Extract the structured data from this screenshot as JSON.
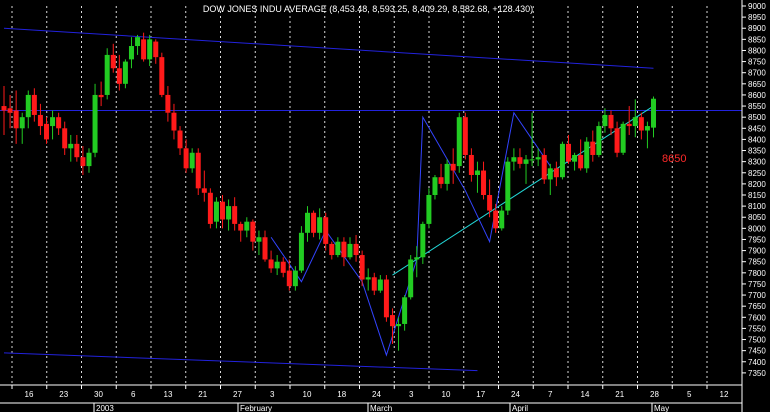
{
  "chart_data": {
    "type": "candlestick",
    "title": "DOW JONES INDU AVERAGE (8,453.48, 8,593.25, 8,409.29, 8,582.68, +128.430)",
    "annotation": "8650",
    "ylim": [
      7300,
      9000
    ],
    "y_ticks": [
      7350,
      7400,
      7450,
      7500,
      7550,
      7600,
      7650,
      7700,
      7750,
      7800,
      7850,
      7900,
      7950,
      8000,
      8050,
      8100,
      8150,
      8200,
      8250,
      8300,
      8350,
      8400,
      8450,
      8500,
      8550,
      8600,
      8650,
      8700,
      8750,
      8800,
      8850,
      8900,
      8950,
      9000
    ],
    "x_day_labels": [
      "16",
      "23",
      "30",
      "6",
      "13",
      "21",
      "27",
      "3",
      "10",
      "18",
      "24",
      "3",
      "10",
      "17",
      "24",
      "7",
      "14",
      "21",
      "28",
      "5",
      "12"
    ],
    "x_month_labels": [
      "2003",
      "February",
      "March",
      "April",
      "May"
    ],
    "grid": true,
    "colors": {
      "background": "#000000",
      "up_candle": "#22cc22",
      "down_candle": "#ff1a1a",
      "grid": "#ffffff",
      "channel": "#2222dd",
      "resistance": "#2222dd",
      "support": "#22d6d6",
      "pattern": "#3344ff",
      "annotation": "#ff2a2a",
      "text": "#ffffff"
    },
    "candles": [
      {
        "o": 8550,
        "h": 8640,
        "l": 8420,
        "c": 8530
      },
      {
        "o": 8540,
        "h": 8600,
        "l": 8450,
        "c": 8520
      },
      {
        "o": 8530,
        "h": 8620,
        "l": 8380,
        "c": 8450
      },
      {
        "o": 8450,
        "h": 8520,
        "l": 8380,
        "c": 8500
      },
      {
        "o": 8500,
        "h": 8620,
        "l": 8450,
        "c": 8600
      },
      {
        "o": 8600,
        "h": 8630,
        "l": 8480,
        "c": 8510
      },
      {
        "o": 8510,
        "h": 8560,
        "l": 8420,
        "c": 8460
      },
      {
        "o": 8470,
        "h": 8500,
        "l": 8380,
        "c": 8400
      },
      {
        "o": 8460,
        "h": 8530,
        "l": 8400,
        "c": 8500
      },
      {
        "o": 8500,
        "h": 8520,
        "l": 8420,
        "c": 8450
      },
      {
        "o": 8450,
        "h": 8480,
        "l": 8330,
        "c": 8360
      },
      {
        "o": 8360,
        "h": 8420,
        "l": 8300,
        "c": 8380
      },
      {
        "o": 8380,
        "h": 8420,
        "l": 8300,
        "c": 8320
      },
      {
        "o": 8320,
        "h": 8370,
        "l": 8240,
        "c": 8280
      },
      {
        "o": 8280,
        "h": 8360,
        "l": 8250,
        "c": 8340
      },
      {
        "o": 8340,
        "h": 8650,
        "l": 8320,
        "c": 8600
      },
      {
        "o": 8600,
        "h": 8660,
        "l": 8550,
        "c": 8590
      },
      {
        "o": 8600,
        "h": 8810,
        "l": 8580,
        "c": 8780
      },
      {
        "o": 8780,
        "h": 8830,
        "l": 8700,
        "c": 8720
      },
      {
        "o": 8720,
        "h": 8780,
        "l": 8620,
        "c": 8650
      },
      {
        "o": 8650,
        "h": 8760,
        "l": 8630,
        "c": 8750
      },
      {
        "o": 8760,
        "h": 8860,
        "l": 8720,
        "c": 8820
      },
      {
        "o": 8820,
        "h": 8870,
        "l": 8780,
        "c": 8860
      },
      {
        "o": 8850,
        "h": 8880,
        "l": 8750,
        "c": 8760
      },
      {
        "o": 8760,
        "h": 8870,
        "l": 8730,
        "c": 8850
      },
      {
        "o": 8840,
        "h": 8850,
        "l": 8740,
        "c": 8770
      },
      {
        "o": 8770,
        "h": 8790,
        "l": 8590,
        "c": 8600
      },
      {
        "o": 8600,
        "h": 8640,
        "l": 8480,
        "c": 8520
      },
      {
        "o": 8520,
        "h": 8560,
        "l": 8400,
        "c": 8440
      },
      {
        "o": 8440,
        "h": 8460,
        "l": 8330,
        "c": 8360
      },
      {
        "o": 8360,
        "h": 8400,
        "l": 8250,
        "c": 8270
      },
      {
        "o": 8270,
        "h": 8360,
        "l": 8250,
        "c": 8340
      },
      {
        "o": 8340,
        "h": 8360,
        "l": 8150,
        "c": 8180
      },
      {
        "o": 8180,
        "h": 8260,
        "l": 8120,
        "c": 8160
      },
      {
        "o": 8160,
        "h": 8180,
        "l": 8000,
        "c": 8020
      },
      {
        "o": 8030,
        "h": 8140,
        "l": 8000,
        "c": 8120
      },
      {
        "o": 8120,
        "h": 8150,
        "l": 8000,
        "c": 8040
      },
      {
        "o": 8040,
        "h": 8130,
        "l": 7990,
        "c": 8100
      },
      {
        "o": 8100,
        "h": 8140,
        "l": 7990,
        "c": 8020
      },
      {
        "o": 8020,
        "h": 8030,
        "l": 7940,
        "c": 7990
      },
      {
        "o": 7990,
        "h": 8050,
        "l": 7960,
        "c": 8030
      },
      {
        "o": 8030,
        "h": 8040,
        "l": 7900,
        "c": 7940
      },
      {
        "o": 7940,
        "h": 7990,
        "l": 7880,
        "c": 7960
      },
      {
        "o": 7960,
        "h": 7990,
        "l": 7850,
        "c": 7860
      },
      {
        "o": 7860,
        "h": 7900,
        "l": 7800,
        "c": 7820
      },
      {
        "o": 7820,
        "h": 7880,
        "l": 7790,
        "c": 7850
      },
      {
        "o": 7850,
        "h": 7870,
        "l": 7780,
        "c": 7800
      },
      {
        "o": 7810,
        "h": 7860,
        "l": 7720,
        "c": 7740
      },
      {
        "o": 7740,
        "h": 7830,
        "l": 7720,
        "c": 7810
      },
      {
        "o": 7810,
        "h": 8010,
        "l": 7800,
        "c": 7980
      },
      {
        "o": 7980,
        "h": 8100,
        "l": 7940,
        "c": 8070
      },
      {
        "o": 8070,
        "h": 8080,
        "l": 7960,
        "c": 7980
      },
      {
        "o": 7980,
        "h": 8090,
        "l": 7950,
        "c": 8050
      },
      {
        "o": 8050,
        "h": 8070,
        "l": 7900,
        "c": 7930
      },
      {
        "o": 7930,
        "h": 7940,
        "l": 7860,
        "c": 7880
      },
      {
        "o": 7880,
        "h": 7960,
        "l": 7870,
        "c": 7940
      },
      {
        "o": 7940,
        "h": 7960,
        "l": 7830,
        "c": 7870
      },
      {
        "o": 7870,
        "h": 7960,
        "l": 7860,
        "c": 7930
      },
      {
        "o": 7930,
        "h": 7970,
        "l": 7850,
        "c": 7880
      },
      {
        "o": 7880,
        "h": 7900,
        "l": 7740,
        "c": 7770
      },
      {
        "o": 7770,
        "h": 7820,
        "l": 7720,
        "c": 7780
      },
      {
        "o": 7780,
        "h": 7800,
        "l": 7700,
        "c": 7720
      },
      {
        "o": 7720,
        "h": 7790,
        "l": 7710,
        "c": 7770
      },
      {
        "o": 7770,
        "h": 7790,
        "l": 7580,
        "c": 7600
      },
      {
        "o": 7610,
        "h": 7640,
        "l": 7480,
        "c": 7560
      },
      {
        "o": 7560,
        "h": 7600,
        "l": 7450,
        "c": 7570
      },
      {
        "o": 7570,
        "h": 7700,
        "l": 7540,
        "c": 7690
      },
      {
        "o": 7690,
        "h": 7880,
        "l": 7680,
        "c": 7860
      },
      {
        "o": 7860,
        "h": 7920,
        "l": 7780,
        "c": 7870
      },
      {
        "o": 7870,
        "h": 8030,
        "l": 7840,
        "c": 8020
      },
      {
        "o": 8020,
        "h": 8180,
        "l": 8000,
        "c": 8150
      },
      {
        "o": 8150,
        "h": 8240,
        "l": 8130,
        "c": 8230
      },
      {
        "o": 8230,
        "h": 8290,
        "l": 8180,
        "c": 8200
      },
      {
        "o": 8200,
        "h": 8310,
        "l": 8170,
        "c": 8290
      },
      {
        "o": 8290,
        "h": 8360,
        "l": 8200,
        "c": 8260
      },
      {
        "o": 8280,
        "h": 8520,
        "l": 8250,
        "c": 8500
      },
      {
        "o": 8500,
        "h": 8520,
        "l": 8310,
        "c": 8330
      },
      {
        "o": 8330,
        "h": 8360,
        "l": 8210,
        "c": 8240
      },
      {
        "o": 8240,
        "h": 8300,
        "l": 8160,
        "c": 8260
      },
      {
        "o": 8260,
        "h": 8300,
        "l": 8130,
        "c": 8150
      },
      {
        "o": 8150,
        "h": 8220,
        "l": 8050,
        "c": 8080
      },
      {
        "o": 8080,
        "h": 8110,
        "l": 7980,
        "c": 8000
      },
      {
        "o": 8000,
        "h": 8100,
        "l": 7990,
        "c": 8080
      },
      {
        "o": 8080,
        "h": 8320,
        "l": 8060,
        "c": 8300
      },
      {
        "o": 8300,
        "h": 8360,
        "l": 8260,
        "c": 8320
      },
      {
        "o": 8320,
        "h": 8360,
        "l": 8270,
        "c": 8290
      },
      {
        "o": 8290,
        "h": 8330,
        "l": 8200,
        "c": 8310
      },
      {
        "o": 8310,
        "h": 8520,
        "l": 8280,
        "c": 8310
      },
      {
        "o": 8310,
        "h": 8360,
        "l": 8280,
        "c": 8320
      },
      {
        "o": 8330,
        "h": 8360,
        "l": 8200,
        "c": 8220
      },
      {
        "o": 8220,
        "h": 8290,
        "l": 8150,
        "c": 8270
      },
      {
        "o": 8270,
        "h": 8300,
        "l": 8190,
        "c": 8230
      },
      {
        "o": 8230,
        "h": 8390,
        "l": 8220,
        "c": 8380
      },
      {
        "o": 8380,
        "h": 8420,
        "l": 8290,
        "c": 8300
      },
      {
        "o": 8300,
        "h": 8340,
        "l": 8260,
        "c": 8330
      },
      {
        "o": 8330,
        "h": 8400,
        "l": 8260,
        "c": 8270
      },
      {
        "o": 8270,
        "h": 8410,
        "l": 8250,
        "c": 8390
      },
      {
        "o": 8390,
        "h": 8440,
        "l": 8300,
        "c": 8330
      },
      {
        "o": 8330,
        "h": 8480,
        "l": 8320,
        "c": 8460
      },
      {
        "o": 8460,
        "h": 8540,
        "l": 8430,
        "c": 8510
      },
      {
        "o": 8510,
        "h": 8530,
        "l": 8420,
        "c": 8450
      },
      {
        "o": 8450,
        "h": 8480,
        "l": 8320,
        "c": 8340
      },
      {
        "o": 8340,
        "h": 8480,
        "l": 8330,
        "c": 8470
      },
      {
        "o": 8470,
        "h": 8550,
        "l": 8420,
        "c": 8460
      },
      {
        "o": 8460,
        "h": 8580,
        "l": 8410,
        "c": 8500
      },
      {
        "o": 8500,
        "h": 8520,
        "l": 8400,
        "c": 8440
      },
      {
        "o": 8440,
        "h": 8480,
        "l": 8360,
        "c": 8460
      },
      {
        "o": 8453,
        "h": 8593,
        "l": 8409,
        "c": 8583
      }
    ],
    "channel_upper": [
      {
        "idx": 0,
        "v": 8900
      },
      {
        "idx": 107,
        "v": 8720
      }
    ],
    "channel_lower": [
      {
        "idx": 0,
        "v": 7440
      },
      {
        "idx": 78,
        "v": 7360
      }
    ],
    "resistance": {
      "v": 8530
    },
    "support": [
      {
        "idx": 64,
        "v": 7790
      },
      {
        "idx": 107,
        "v": 8550
      }
    ],
    "pattern": [
      {
        "idx": 44,
        "v": 7960
      },
      {
        "idx": 49,
        "v": 7760
      },
      {
        "idx": 53,
        "v": 7990
      },
      {
        "idx": 59,
        "v": 7760
      },
      {
        "idx": 63,
        "v": 7430
      },
      {
        "idx": 68,
        "v": 7860
      },
      {
        "idx": 69,
        "v": 8500
      },
      {
        "idx": 76,
        "v": 8170
      },
      {
        "idx": 80,
        "v": 7940
      },
      {
        "idx": 84,
        "v": 8520
      },
      {
        "idx": 90,
        "v": 8280
      }
    ]
  }
}
